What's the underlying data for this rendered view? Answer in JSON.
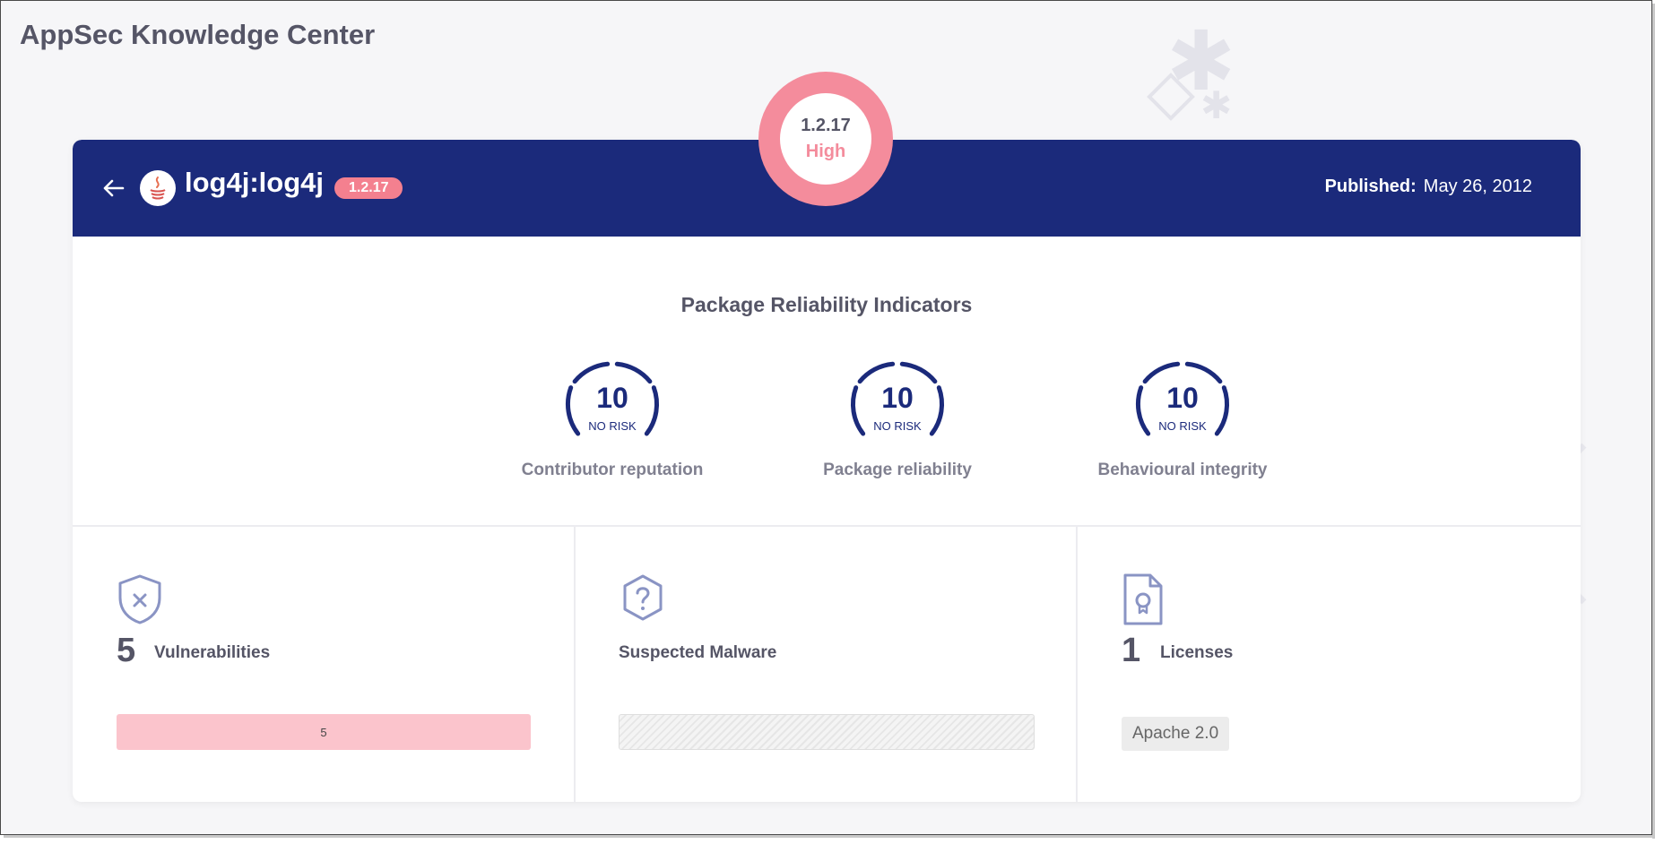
{
  "page": {
    "title": "AppSec Knowledge Center"
  },
  "header": {
    "package_name": "log4j:log4j",
    "version": "1.2.17",
    "published_label": "Published:",
    "published_date": "May 26, 2012",
    "back_icon": "arrow-left-icon",
    "logo_icon": "java-logo-icon"
  },
  "severity": {
    "version": "1.2.17",
    "level": "High",
    "color": "#f48c9c"
  },
  "reliability": {
    "title": "Package Reliability Indicators",
    "indicators": [
      {
        "score": "10",
        "risk": "NO RISK",
        "label": "Contributor reputation"
      },
      {
        "score": "10",
        "risk": "NO RISK",
        "label": "Package reliability"
      },
      {
        "score": "10",
        "risk": "NO RISK",
        "label": "Behavioural integrity"
      }
    ]
  },
  "vulnerabilities": {
    "count": "5",
    "label": "Vulnerabilities",
    "bar_value": "5",
    "icon": "shield-x-icon",
    "color": "#fbc4cc"
  },
  "malware": {
    "label": "Suspected Malware",
    "icon": "question-hexagon-icon"
  },
  "licenses": {
    "count": "1",
    "label": "Licenses",
    "items": [
      "Apache 2.0"
    ],
    "icon": "license-document-icon"
  },
  "colors": {
    "brand": "#1b2a7b",
    "severity_high": "#f48c9c",
    "muted_text": "#808090"
  }
}
